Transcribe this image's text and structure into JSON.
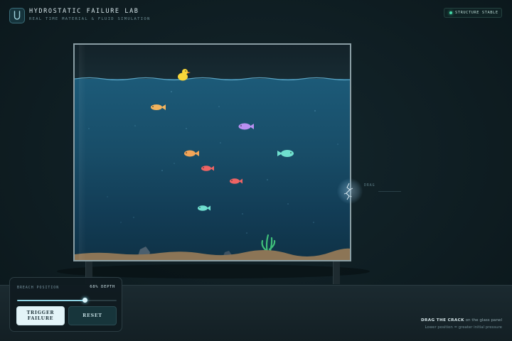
{
  "header": {
    "title": "HYDROSTATIC FAILURE LAB",
    "subtitle": "REAL TIME MATERIAL & FLUID SIMULATION",
    "logo_icon": "u-logo-icon"
  },
  "status": {
    "label": "STRUCTURE STABLE",
    "color": "#45d9a8"
  },
  "tank": {
    "water_color": "#1c5a78",
    "fish": [
      {
        "color": "#f2b45e",
        "direction": "right"
      },
      {
        "color": "#b98ff0",
        "direction": "right"
      },
      {
        "color": "#f2a558",
        "direction": "right"
      },
      {
        "color": "#6fe0cf",
        "direction": "left"
      },
      {
        "color": "#ef6464",
        "direction": "right"
      },
      {
        "color": "#ef6464",
        "direction": "right"
      },
      {
        "color": "#6fe0d0",
        "direction": "right"
      }
    ],
    "duck_color": "#f7d63a"
  },
  "crack_handle": {
    "label": "DRAG",
    "icon": "crack-icon"
  },
  "panel": {
    "label": "BREACH POSITION",
    "value_text": "68% DEPTH",
    "slider_fraction": 0.68,
    "trigger_label_line1": "TRIGGER",
    "trigger_label_line2": "FAILURE",
    "reset_label": "RESET"
  },
  "hint": {
    "bold": "DRAG THE CRACK",
    "rest": " on the glass panel",
    "line2": "Lower position = greater initial pressure"
  }
}
